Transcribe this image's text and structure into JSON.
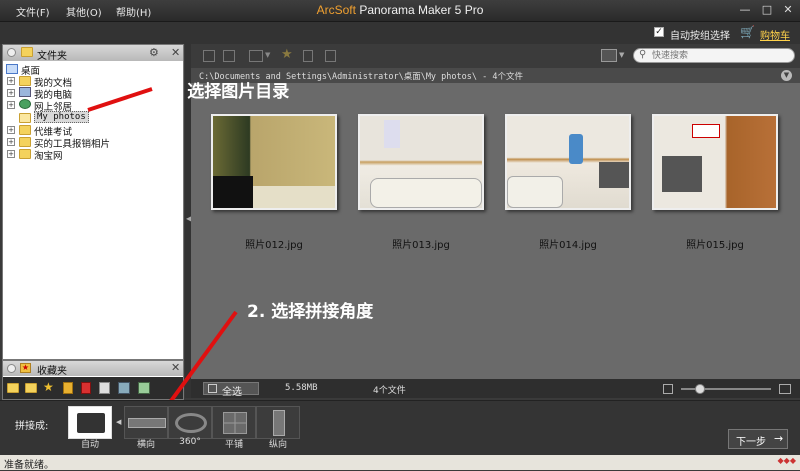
{
  "menu": {
    "file": "文件(F)",
    "other": "其他(O)",
    "help": "帮助(H)"
  },
  "app_title": {
    "brand": "ArcSoft",
    "product": "Panorama Maker 5 Pro"
  },
  "top_options": {
    "auto_select": "自动按组选择",
    "cart": "购物车"
  },
  "search": {
    "placeholder": "快速搜索"
  },
  "folder_pane": {
    "title": "文件夹",
    "tree": [
      {
        "label": "桌面",
        "icon": "desktop-icon"
      },
      {
        "label": "我的文档",
        "icon": "documents-icon"
      },
      {
        "label": "我的电脑",
        "icon": "computer-icon"
      },
      {
        "label": "网上邻居",
        "icon": "network-icon"
      },
      {
        "label": "My photos",
        "icon": "folder-icon",
        "selected": true
      },
      {
        "label": "代维考试",
        "icon": "folder-icon"
      },
      {
        "label": "买的工具报销相片",
        "icon": "folder-icon"
      },
      {
        "label": "淘宝网",
        "icon": "folder-icon"
      }
    ]
  },
  "fav_pane": {
    "title": "收藏夹"
  },
  "path": "C:\\Documents and Settings\\Administrator\\桌面\\My photos\\ - 4个文件",
  "thumbnails": [
    {
      "label": "照片012.jpg"
    },
    {
      "label": "照片013.jpg"
    },
    {
      "label": "照片014.jpg"
    },
    {
      "label": "照片015.jpg"
    }
  ],
  "status": {
    "select_all": "全选",
    "size": "5.58MB",
    "count": "4个文件"
  },
  "stitch": {
    "label": "拼接成:",
    "modes": [
      "自动",
      "横向",
      "360°",
      "平铺",
      "纵向"
    ],
    "next": "下一步"
  },
  "footer": {
    "ready": "准备就绪。"
  },
  "annotations": {
    "step1": "1. 选择图片目录",
    "step2": "2. 选择拼接角度"
  },
  "colors": {
    "brand": "#f0a030",
    "annotation_arrow": "#e01010"
  }
}
